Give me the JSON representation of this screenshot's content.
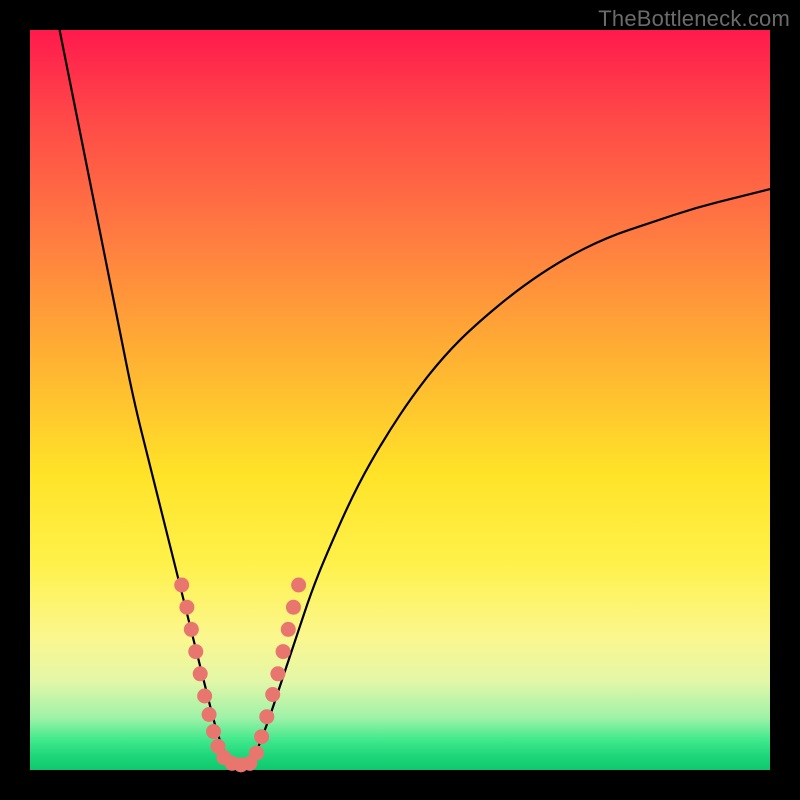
{
  "watermark": "TheBottleneck.com",
  "chart_data": {
    "type": "line",
    "title": "",
    "xlabel": "",
    "ylabel": "",
    "xlim": [
      0,
      100
    ],
    "ylim": [
      0,
      100
    ],
    "left_curve": {
      "name": "left-branch",
      "x": [
        4,
        6,
        8,
        10,
        12,
        14,
        16,
        18,
        20,
        21,
        22,
        23,
        24,
        25,
        26,
        27
      ],
      "y": [
        100,
        90,
        80,
        70,
        60,
        50,
        42,
        34,
        26,
        22,
        18,
        14,
        10,
        6,
        3,
        1
      ]
    },
    "right_curve": {
      "name": "right-branch",
      "x": [
        30,
        32,
        34,
        36,
        38,
        40,
        44,
        48,
        52,
        56,
        60,
        66,
        72,
        78,
        84,
        90,
        96,
        100
      ],
      "y": [
        1,
        6,
        12,
        18,
        24,
        29,
        38,
        45,
        51,
        56,
        60,
        65,
        69,
        72,
        74,
        76,
        77.5,
        78.5
      ]
    },
    "flat_segment": {
      "name": "valley",
      "x": [
        27,
        28.5,
        30
      ],
      "y": [
        1,
        0.6,
        1
      ]
    },
    "dots": [
      {
        "x": 20.5,
        "y": 25
      },
      {
        "x": 21.2,
        "y": 22
      },
      {
        "x": 21.8,
        "y": 19
      },
      {
        "x": 22.4,
        "y": 16
      },
      {
        "x": 23.0,
        "y": 13
      },
      {
        "x": 23.6,
        "y": 10
      },
      {
        "x": 24.2,
        "y": 7.5
      },
      {
        "x": 24.8,
        "y": 5.2
      },
      {
        "x": 25.4,
        "y": 3.2
      },
      {
        "x": 26.2,
        "y": 1.7
      },
      {
        "x": 27.3,
        "y": 0.9
      },
      {
        "x": 28.5,
        "y": 0.7
      },
      {
        "x": 29.7,
        "y": 0.9
      },
      {
        "x": 30.6,
        "y": 2.3
      },
      {
        "x": 31.3,
        "y": 4.5
      },
      {
        "x": 32.0,
        "y": 7.2
      },
      {
        "x": 32.8,
        "y": 10.2
      },
      {
        "x": 33.5,
        "y": 13.0
      },
      {
        "x": 34.2,
        "y": 16.0
      },
      {
        "x": 34.9,
        "y": 19.0
      },
      {
        "x": 35.6,
        "y": 22.0
      },
      {
        "x": 36.3,
        "y": 25.0
      }
    ],
    "dot_radius": 7.5,
    "colors": {
      "curve": "#000000",
      "dot": "#e9756f",
      "gradient_top": "#ff1a4d",
      "gradient_bottom": "#0fc86d"
    }
  }
}
